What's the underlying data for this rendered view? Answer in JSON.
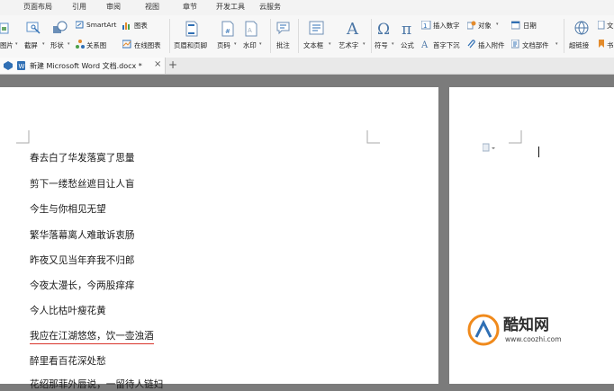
{
  "menu": [
    "页面布局",
    "引用",
    "审阅",
    "视图",
    "章节",
    "开发工具",
    "云服务"
  ],
  "ribbon": {
    "picture_partial": "图片",
    "screenshot": "截屏",
    "shapes": "形状",
    "smartart": "SmartArt",
    "chart": "图表",
    "relation": "关系图",
    "online_chart": "在线图表",
    "header_footer": "页眉和页脚",
    "page_number": "页码",
    "watermark": "水印",
    "comment": "批注",
    "textbox": "文本框",
    "wordart": "艺术字",
    "symbol": "符号",
    "formula": "公式",
    "insert_number": "插入数字",
    "first_letter": "首字下沉",
    "object": "对象",
    "insert_attachment": "插入附件",
    "date": "日期",
    "doc_parts": "文档部件",
    "hyperlink": "超链接",
    "partial_right_top": "文",
    "partial_right_bottom": "书"
  },
  "tab": {
    "title": "新建 Microsoft Word 文档.docx *",
    "close": "×",
    "new": "+"
  },
  "document": {
    "lines": [
      "春去白了华发落寞了思量",
      "剪下一缕愁丝遮目让人盲",
      "今生与你相见无望",
      "繁华落幕离人难敢诉衷肠",
      "昨夜又见当年弃我不归郎",
      "今夜太漫长，今两股痒痒",
      "今人比枯叶瘦花黄",
      "我应在江湖悠悠，饮一壶浊酒",
      "醉里看百花深处愁",
      "花绍那菲外唇说，一留待人链妇"
    ],
    "underline_color": "#d9342b"
  },
  "watermark": {
    "name": "酷知网",
    "url": "www.coozhi.com"
  },
  "colors": {
    "accent": "#2f6fb4",
    "brand_orange": "#f08a1c"
  }
}
